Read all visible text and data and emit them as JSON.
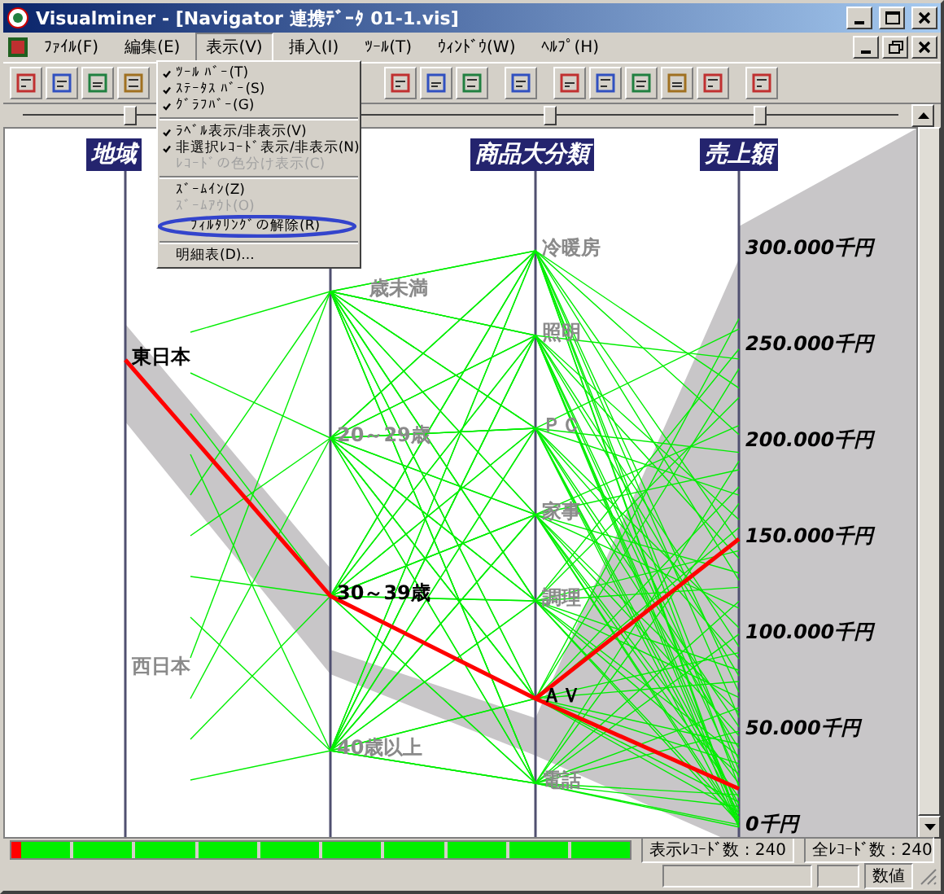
{
  "window": {
    "title": "Visualminer - [Navigator 連携ﾃﾞｰﾀ 01-1.vis]"
  },
  "menu_bar": [
    {
      "label": "ﾌｧｲﾙ(F)",
      "selected": false
    },
    {
      "label": "編集(E)",
      "selected": false
    },
    {
      "label": "表示(V)",
      "selected": true
    },
    {
      "label": "挿入(I)",
      "selected": false
    },
    {
      "label": "ﾂｰﾙ(T)",
      "selected": false
    },
    {
      "label": "ｳｨﾝﾄﾞｳ(W)",
      "selected": false
    },
    {
      "label": "ﾍﾙﾌﾟ(H)",
      "selected": false
    }
  ],
  "view_menu": [
    {
      "kind": "item",
      "label": "ﾂｰﾙ ﾊﾞｰ(T)",
      "checked": true,
      "disabled": false,
      "circled": false
    },
    {
      "kind": "item",
      "label": "ｽﾃｰﾀｽ ﾊﾞｰ(S)",
      "checked": true,
      "disabled": false,
      "circled": false
    },
    {
      "kind": "item",
      "label": "ｸﾞﾗﾌﾊﾞｰ(G)",
      "checked": true,
      "disabled": false,
      "circled": false
    },
    {
      "kind": "separator"
    },
    {
      "kind": "item",
      "label": "ﾗﾍﾞﾙ表示/非表示(V)",
      "checked": true,
      "disabled": false,
      "circled": false
    },
    {
      "kind": "item",
      "label": "非選択ﾚｺｰﾄﾞ表示/非表示(N)",
      "checked": true,
      "disabled": false,
      "circled": false
    },
    {
      "kind": "item",
      "label": "ﾚｺｰﾄﾞの色分け表示(C)",
      "checked": false,
      "disabled": true,
      "circled": false
    },
    {
      "kind": "separator"
    },
    {
      "kind": "item",
      "label": "ｽﾞｰﾑｲﾝ(Z)",
      "checked": false,
      "disabled": false,
      "circled": false
    },
    {
      "kind": "item",
      "label": "ｽﾞｰﾑｱｳﾄ(O)",
      "checked": false,
      "disabled": true,
      "circled": false
    },
    {
      "kind": "item",
      "label": "ﾌｨﾙﾀﾘﾝｸﾞの解除(R)",
      "checked": false,
      "disabled": false,
      "circled": true
    },
    {
      "kind": "separator"
    },
    {
      "kind": "item",
      "label": "明細表(D)...",
      "checked": false,
      "disabled": false,
      "circled": false
    }
  ],
  "axes": [
    {
      "label": "地域",
      "categories": [
        {
          "text": "東日本",
          "selected": true
        },
        {
          "text": "西日本",
          "selected": false
        }
      ]
    },
    {
      "categories": [
        {
          "text": "歳未満",
          "selected": false
        },
        {
          "text": "20～29歳",
          "selected": false
        },
        {
          "text": "30～39歳",
          "selected": true
        },
        {
          "text": "40歳以上",
          "selected": false
        }
      ]
    },
    {
      "label": "商品大分類",
      "categories": [
        {
          "text": "冷暖房",
          "selected": false
        },
        {
          "text": "照明",
          "selected": false
        },
        {
          "text": "ＰＣ",
          "selected": false
        },
        {
          "text": "家事",
          "selected": false
        },
        {
          "text": "調理",
          "selected": false
        },
        {
          "text": "ＡＶ",
          "selected": true
        },
        {
          "text": "電話",
          "selected": false
        }
      ]
    },
    {
      "label": "売上額",
      "ticks": [
        "300.000千円",
        "250.000千円",
        "200.000千円",
        "150.000千円",
        "100.000千円",
        "50.000千円",
        "0千円"
      ]
    }
  ],
  "axis_slider": {
    "thumbs": [
      {
        "level": 0.12
      },
      {
        "level": 0.6
      },
      {
        "level": 0.84
      }
    ]
  },
  "graph_bar": {
    "level": 0.015
  },
  "status": {
    "shown_records": "表示ﾚｺｰﾄﾞ数 : 240",
    "all_records": "全ﾚｺｰﾄﾞ数 : 240",
    "mode": "数値"
  }
}
